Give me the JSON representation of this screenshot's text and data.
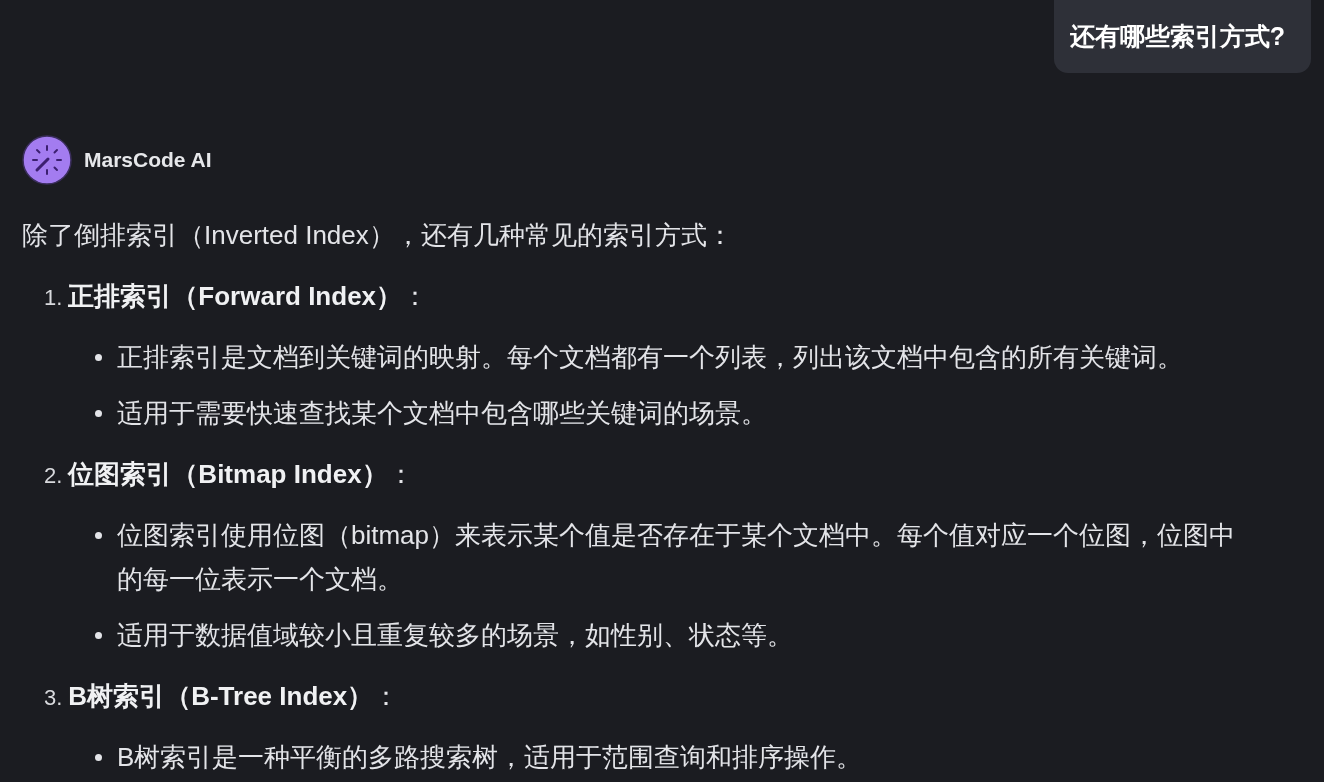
{
  "user_message": {
    "text": "还有哪些索引方式?"
  },
  "assistant": {
    "name": "MarsCode AI"
  },
  "answer": {
    "intro": "除了倒排索引（Inverted Index），还有几种常见的索引方式：",
    "items": [
      {
        "number": "1.",
        "heading": "**正排索引（Forward Index）**：",
        "points": [
          "正排索引是文档到关键词的映射。每个文档都有一个列表，列出该文档中包含的所有关键词。",
          "适用于需要快速查找某个文档中包含哪些关键词的场景。"
        ]
      },
      {
        "number": "2.",
        "heading": "**位图索引（Bitmap Index）**：",
        "points": [
          "位图索引使用位图（bitmap）来表示某个值是否存在于某个文档中。每个值对应一个位图，位图中的每一位表示一个文档。",
          "适用于数据值域较小且重复较多的场景，如性别、状态等。"
        ]
      },
      {
        "number": "3.",
        "heading": "**B树索引（B-Tree Index）**：",
        "points": [
          "B树索引是一种平衡的多路搜索树，适用于范围查询和排序操作。"
        ]
      }
    ]
  }
}
